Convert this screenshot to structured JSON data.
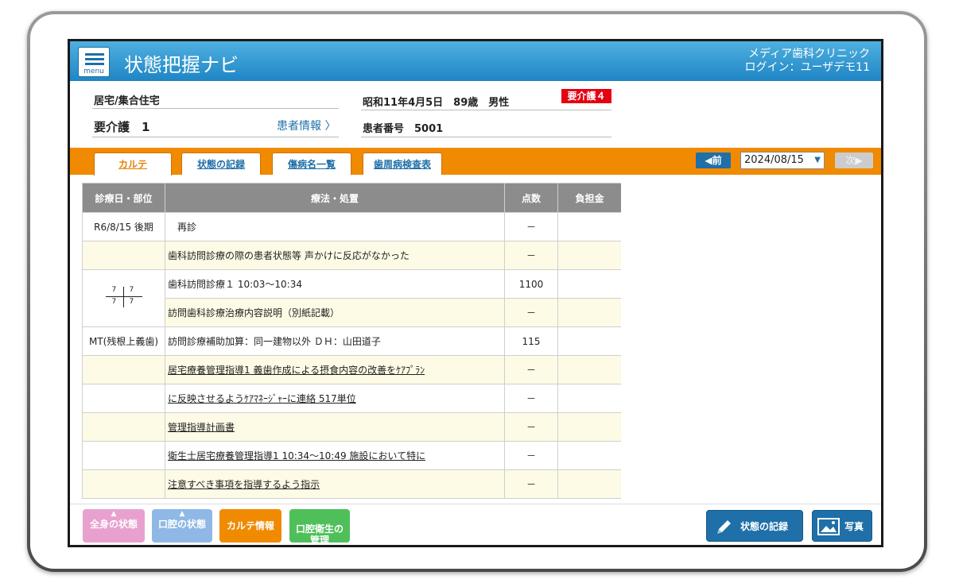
{
  "header": {
    "menu_label": "menu",
    "app_title": "状態把握ナビ",
    "clinic_name": "メディア歯科クリニック",
    "login_text": "ログイン：ユーザデモ11"
  },
  "patient": {
    "residence": "居宅/集合住宅",
    "birth_age_sex": "昭和11年4月5日　89歳　男性",
    "care_badge": "要介護４",
    "care_level": "要介護　1",
    "patient_info_link": "患者情報 〉",
    "patient_number": "患者番号　5001",
    "badge_color": "#e60012"
  },
  "tabs": [
    {
      "label": "カルテ",
      "active": true
    },
    {
      "label": "状態の記録"
    },
    {
      "label": "傷病名一覧"
    },
    {
      "label": "歯周病検査表"
    }
  ],
  "date_nav": {
    "prev_label": "◀前",
    "date_value": "2024/08/15",
    "next_label": "次▶"
  },
  "table": {
    "headers": [
      "診療日・部位",
      "療法・処置",
      "点数",
      "負担金"
    ],
    "rows": [
      {
        "date": "R6/8/15 後期",
        "treatment": "　再診",
        "points": "－",
        "fee": ""
      },
      {
        "date": "",
        "treatment": "歯科訪問診療の際の患者状態等 声かけに反応がなかった",
        "points": "－",
        "fee": ""
      },
      {
        "date": "",
        "treatment": "歯科訪問診療１ 10:03～10:34",
        "points": "1100",
        "fee": ""
      },
      {
        "date": "",
        "treatment": "訪問歯科診療治療内容説明（別紙記載）",
        "points": "－",
        "fee": ""
      },
      {
        "date": "MT(残根上義歯)",
        "treatment": "訪問診療補助加算：同一建物以外 ＤＨ：山田道子",
        "points": "115",
        "fee": ""
      },
      {
        "date": "",
        "treatment": "居宅療養管理指導1 義歯作成による摂食内容の改善をｹｱﾌﾟﾗﾝ",
        "points": "－",
        "fee": ""
      },
      {
        "date": "",
        "treatment": "に反映させるようｹｱﾏﾈｰｼﾞｬｰに連絡 517単位",
        "points": "－",
        "fee": ""
      },
      {
        "date": "",
        "treatment": "管理指導計画書",
        "points": "－",
        "fee": ""
      },
      {
        "date": "",
        "treatment": "衛生士居宅療養管理指導1 10:34～10:49 施設において特に",
        "points": "－",
        "fee": ""
      },
      {
        "date": "",
        "treatment": "注意すべき事項を指導するよう指示",
        "points": "－",
        "fee": ""
      },
      {
        "date": "",
        "treatment": "",
        "points": "",
        "fee": ""
      }
    ],
    "tooth_chart": {
      "ul": "7",
      "ur": "7",
      "ll": "7",
      "lr": "7"
    }
  },
  "bottom": {
    "buttons": [
      {
        "label": "全身の状態",
        "color": "#e8a0cf"
      },
      {
        "label": "口腔の状態",
        "color": "#8fb8e6"
      },
      {
        "label": "カルテ情報",
        "color": "#f08a00"
      },
      {
        "label": "口腔衛生の\n管理",
        "color": "#4fbf5a"
      }
    ],
    "record_label": "状態の記録",
    "photo_label": "写真"
  }
}
